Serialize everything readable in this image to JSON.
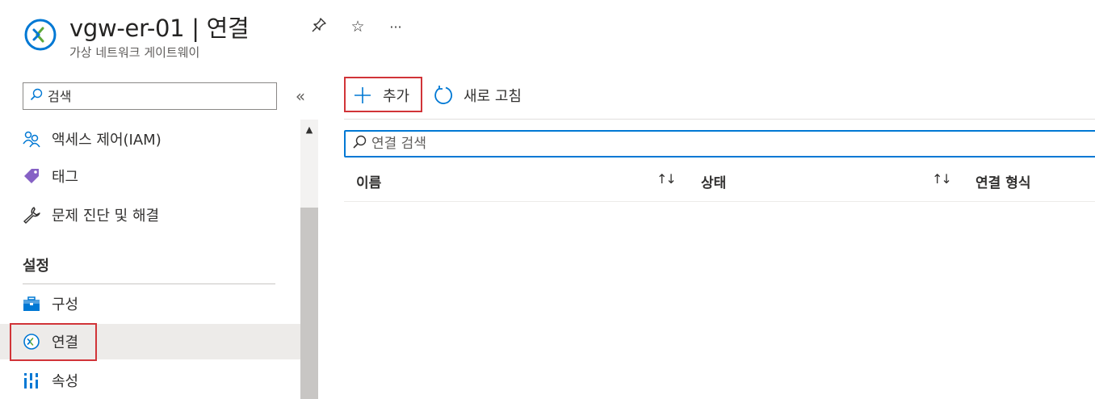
{
  "header": {
    "title": "vgw-er-01 | 연결",
    "subtitle": "가상 네트워크 게이트웨이",
    "icon": "gateway-icon",
    "actions": [
      {
        "name": "pin",
        "glyph": "⚲"
      },
      {
        "name": "favorite",
        "glyph": "☆"
      },
      {
        "name": "more",
        "glyph": "···"
      }
    ]
  },
  "sidebar": {
    "search_placeholder": "검색",
    "collapse_glyph": "«",
    "items": [
      {
        "label": "액세스 제어(IAM)",
        "icon": "people-icon"
      },
      {
        "label": "태그",
        "icon": "tag-icon"
      },
      {
        "label": "문제 진단 및 해결",
        "icon": "wrench-icon"
      }
    ],
    "section_title": "설정",
    "settings_items": [
      {
        "label": "구성",
        "icon": "toolbox-icon"
      },
      {
        "label": "연결",
        "icon": "connection-icon",
        "active": true
      },
      {
        "label": "속성",
        "icon": "properties-icon"
      }
    ]
  },
  "toolbar": {
    "add_label": "추가",
    "refresh_label": "새로 고침"
  },
  "main": {
    "search_placeholder": "연결 검색",
    "columns": [
      {
        "label": "이름",
        "sort": "↑↓"
      },
      {
        "label": "상태",
        "sort": "↑↓"
      },
      {
        "label": "연결 형식"
      }
    ]
  },
  "colors": {
    "accent": "#0078d4",
    "highlight_border": "#d13438",
    "icon_green": "#5ea83a",
    "tag_purple": "#8661c5"
  }
}
